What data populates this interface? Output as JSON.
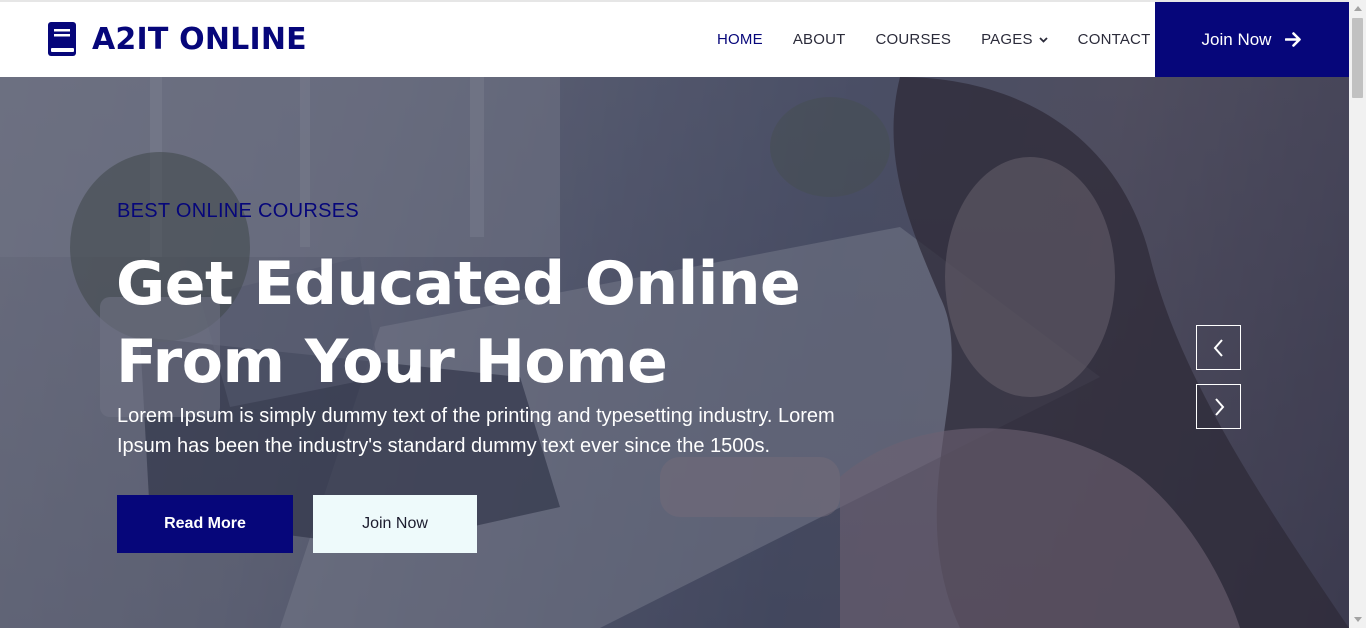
{
  "brand": {
    "name": "A2IT ONLINE",
    "icon": "book-icon"
  },
  "nav": {
    "items": [
      {
        "label": "HOME",
        "active": true
      },
      {
        "label": "ABOUT"
      },
      {
        "label": "COURSES"
      },
      {
        "label": "PAGES",
        "dropdown": true
      },
      {
        "label": "CONTACT"
      }
    ],
    "cta_label": "Join Now",
    "cta_icon": "arrow-right-icon"
  },
  "hero": {
    "subtitle": "BEST ONLINE COURSES",
    "title_line1": "Get Educated Online",
    "title_line2": "From Your Home",
    "description": "Lorem Ipsum is simply dummy text of the printing and typesetting industry. Lorem Ipsum has been the industry's standard dummy text ever since the 1500s.",
    "primary_button": "Read More",
    "secondary_button": "Join Now",
    "prev_icon": "chevron-left-icon",
    "next_icon": "chevron-right-icon"
  },
  "colors": {
    "primary": "#06067a",
    "light_button": "#eefafb",
    "overlay": "#181d38"
  }
}
